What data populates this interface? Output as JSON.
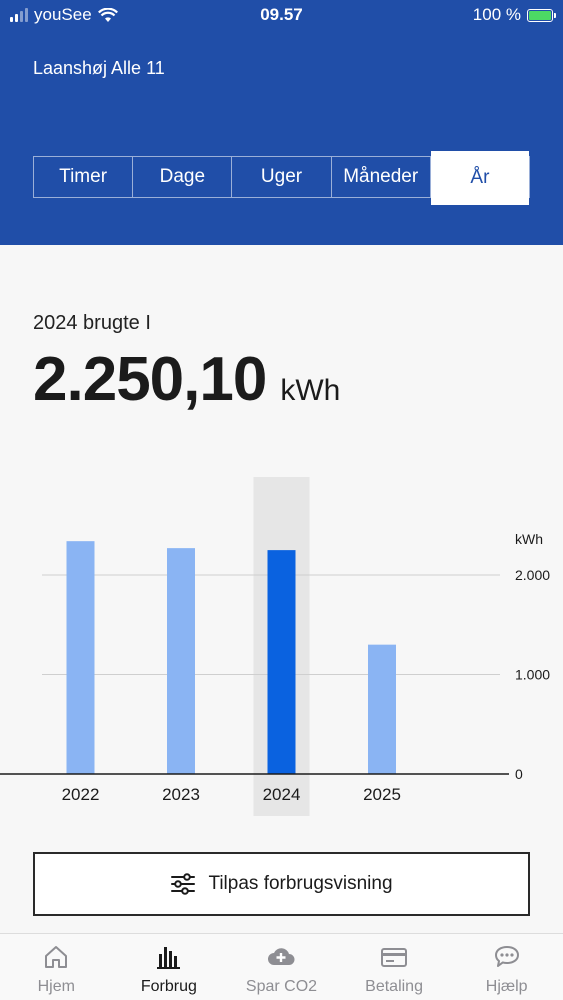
{
  "status_bar": {
    "carrier": "youSee",
    "time": "09.57",
    "battery": "100 %"
  },
  "address": "Laanshøj Alle 11",
  "period_tabs": [
    {
      "label": "Timer",
      "active": false
    },
    {
      "label": "Dage",
      "active": false
    },
    {
      "label": "Uger",
      "active": false
    },
    {
      "label": "Måneder",
      "active": false
    },
    {
      "label": "År",
      "active": true
    }
  ],
  "summary": {
    "label": "2024 brugte I",
    "value": "2.250,10",
    "unit": "kWh"
  },
  "chart_data": {
    "type": "bar",
    "categories": [
      "2022",
      "2023",
      "2024",
      "2025"
    ],
    "values": [
      2340,
      2270,
      2250,
      1300
    ],
    "selected": "2024",
    "ylabel": "kWh",
    "ylim": [
      0,
      2500
    ],
    "yticks": [
      0,
      1000,
      2000
    ],
    "ytick_labels": [
      "0",
      "1.000",
      "2.000"
    ],
    "grid": true,
    "colors": {
      "bar": "#8ab4f3",
      "selected_bar": "#0a62e0",
      "highlight": "#e6e6e6"
    }
  },
  "customize_button": {
    "label": "Tilpas forbrugsvisning"
  },
  "tabbar": [
    {
      "label": "Hjem",
      "icon": "home-icon",
      "active": false
    },
    {
      "label": "Forbrug",
      "icon": "bar-chart-icon",
      "active": true
    },
    {
      "label": "Spar CO2",
      "icon": "cloud-plus-icon",
      "active": false
    },
    {
      "label": "Betaling",
      "icon": "credit-card-icon",
      "active": false
    },
    {
      "label": "Hjælp",
      "icon": "chat-icon",
      "active": false
    }
  ],
  "colors": {
    "header": "#204ea8",
    "accent": "#0a62e0"
  }
}
